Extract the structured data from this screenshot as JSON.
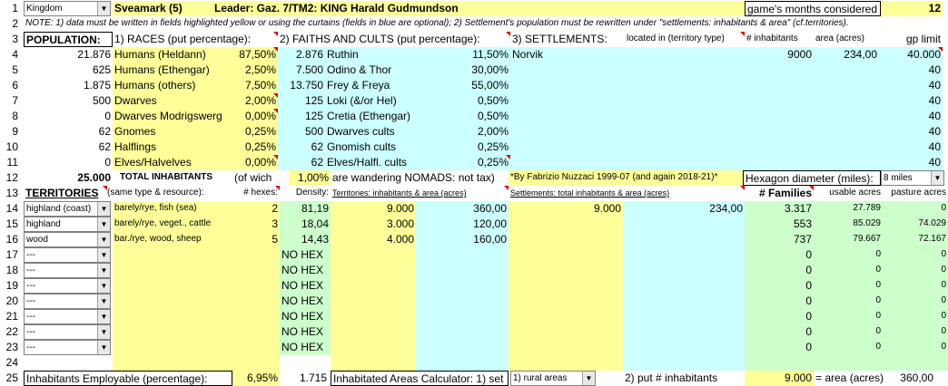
{
  "header": {
    "kingdom_select": "Kingdom",
    "realm_name": "Sveamark (5)",
    "leader": "Leader: Gaz. 7/TM2: KING Harald Gudmundson",
    "months_label": "game's months considered",
    "months_value": "12"
  },
  "note": "NOTE: 1) data must be written in fields highlighted yellow or using the curtains (fields in blue are optional); 2) Settlement's population must be rewritten under \"settlements: inhabitants & area\" (cf.territories).",
  "row_numbers": [
    "1",
    "2",
    "3",
    "4",
    "5",
    "6",
    "7",
    "8",
    "9",
    "10",
    "11",
    "12",
    "13",
    "14",
    "15",
    "16",
    "17",
    "18",
    "19",
    "20",
    "21",
    "22",
    "23",
    "24",
    "25"
  ],
  "population": {
    "title": "POPULATION:",
    "races_header": "1) RACES (put percentage):",
    "races": [
      {
        "count": "21.876",
        "name": "Humans (Heldann)",
        "pct": "87,50%"
      },
      {
        "count": "625",
        "name": "Humans (Ethengar)",
        "pct": "2,50%"
      },
      {
        "count": "1.875",
        "name": "Humans (others)",
        "pct": "7,50%"
      },
      {
        "count": "500",
        "name": "Dwarves",
        "pct": "2,00%"
      },
      {
        "count": "0",
        "name": "Dwarves Modrigswerg",
        "pct": "0,00%"
      },
      {
        "count": "62",
        "name": "Gnomes",
        "pct": "0,25%"
      },
      {
        "count": "62",
        "name": "Halflings",
        "pct": "0,25%"
      },
      {
        "count": "0",
        "name": "Elves/Halvelves",
        "pct": "0,00%"
      }
    ],
    "faiths_header": "2) FAITHS AND CULTS (put percentage):",
    "faiths": [
      {
        "count": "2.876",
        "name": "Ruthin",
        "pct": "11,50%"
      },
      {
        "count": "7.500",
        "name": "Odino & Thor",
        "pct": "30,00%"
      },
      {
        "count": "13.750",
        "name": "Frey & Freya",
        "pct": "55,00%"
      },
      {
        "count": "125",
        "name": "Loki (&/or Hel)",
        "pct": "0,50%"
      },
      {
        "count": "125",
        "name": "Cretia (Ethengar)",
        "pct": "0,50%"
      },
      {
        "count": "500",
        "name": "Dwarves cults",
        "pct": "2,00%"
      },
      {
        "count": "62",
        "name": "Gnomish cults",
        "pct": "0,25%"
      },
      {
        "count": "62",
        "name": "Elves/Halfl. cults",
        "pct": "0,25%"
      }
    ],
    "settlements_header": "3) SETTLEMENTS:",
    "located_header": "located in (territory type)",
    "inhab_header": "# inhabitants",
    "area_header": "area (acres)",
    "gp_header": "gp limit",
    "settlement_name": "Norvik",
    "settlement_inhab": "9000",
    "settlement_area": "234,00",
    "gp_limits": [
      "40.000",
      "40",
      "40",
      "40",
      "40",
      "40",
      "40",
      "40"
    ]
  },
  "totals": {
    "total_value": "25.000",
    "total_label": "TOTAL INHABITANTS",
    "of_wich": "(of wich",
    "nomads_pct": "1,00%",
    "nomads_label": "are wandering NOMADS: not tax)",
    "credit": "*By Fabrizio Nuzzaci 1999-07 (and again 2018-21)*",
    "hex_label": "Hexagon diameter (miles):",
    "hex_value": "8 miles"
  },
  "territories": {
    "title": "TERRITORIES",
    "subtitle": "(same type & resource):",
    "hexes_header": "# hexes:",
    "density_header": "Density:",
    "terr_inhab_header": "Territories: inhabitants & area (acres)",
    "sett_inhab_header": "Settlements: total inhabitants & area (acres)",
    "families_header": "# Families",
    "usable_header": "usable acres",
    "pasture_header": "pasture acres",
    "rows": [
      {
        "type": "highland (coast)",
        "resource": "barely/rye, fish (sea)",
        "hexes": "2",
        "density": "81,19",
        "t_inhab": "9.000",
        "t_area": "360,00",
        "s_inhab": "9.000",
        "s_area": "234,00",
        "families": "3.317",
        "usable": "27.789",
        "pasture": "0"
      },
      {
        "type": "highland",
        "resource": "barely/rye, veget., cattle",
        "hexes": "3",
        "density": "18,04",
        "t_inhab": "3.000",
        "t_area": "120,00",
        "s_inhab": "",
        "s_area": "",
        "families": "553",
        "usable": "85.029",
        "pasture": "74.029"
      },
      {
        "type": "wood",
        "resource": "bar./rye, wood, sheep",
        "hexes": "5",
        "density": "14,43",
        "t_inhab": "4.000",
        "t_area": "160,00",
        "s_inhab": "",
        "s_area": "",
        "families": "737",
        "usable": "79.667",
        "pasture": "72.167"
      },
      {
        "type": "---",
        "resource": "",
        "hexes": "",
        "density": "NO HEX",
        "t_inhab": "",
        "t_area": "",
        "s_inhab": "",
        "s_area": "",
        "families": "0",
        "usable": "0",
        "pasture": "0"
      },
      {
        "type": "---",
        "resource": "",
        "hexes": "",
        "density": "NO HEX",
        "t_inhab": "",
        "t_area": "",
        "s_inhab": "",
        "s_area": "",
        "families": "0",
        "usable": "0",
        "pasture": "0"
      },
      {
        "type": "---",
        "resource": "",
        "hexes": "",
        "density": "NO HEX",
        "t_inhab": "",
        "t_area": "",
        "s_inhab": "",
        "s_area": "",
        "families": "0",
        "usable": "0",
        "pasture": "0"
      },
      {
        "type": "---",
        "resource": "",
        "hexes": "",
        "density": "NO HEX",
        "t_inhab": "",
        "t_area": "",
        "s_inhab": "",
        "s_area": "",
        "families": "0",
        "usable": "0",
        "pasture": "0"
      },
      {
        "type": "---",
        "resource": "",
        "hexes": "",
        "density": "NO HEX",
        "t_inhab": "",
        "t_area": "",
        "s_inhab": "",
        "s_area": "",
        "families": "0",
        "usable": "0",
        "pasture": "0"
      },
      {
        "type": "---",
        "resource": "",
        "hexes": "",
        "density": "NO HEX",
        "t_inhab": "",
        "t_area": "",
        "s_inhab": "",
        "s_area": "",
        "families": "0",
        "usable": "0",
        "pasture": "0"
      },
      {
        "type": "---",
        "resource": "",
        "hexes": "",
        "density": "NO HEX",
        "t_inhab": "",
        "t_area": "",
        "s_inhab": "",
        "s_area": "",
        "families": "0",
        "usable": "0",
        "pasture": "0"
      }
    ]
  },
  "footer": {
    "employable_label": "Inhabitants Employable (percentage):",
    "employable_pct": "6,95%",
    "employable_value": "1.715",
    "calc_label": "Inhabitated Areas Calculator: 1) set",
    "calc_select": "1) rural areas",
    "calc_step2": "2) put # inhabitants",
    "calc_inhab": "9.000",
    "calc_area_label": "= area (acres)",
    "calc_area": "360,00"
  },
  "colors": {
    "yellow": "#ffff99",
    "blue": "#ccffff",
    "green": "#ccffcc",
    "marker": "#e00000"
  }
}
